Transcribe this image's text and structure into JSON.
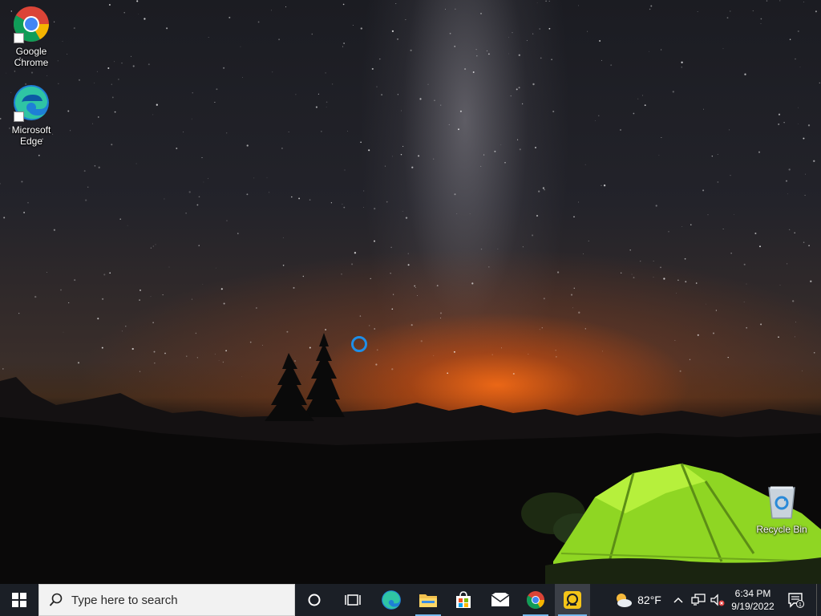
{
  "desktop": {
    "icons": [
      {
        "id": "chrome",
        "label_line1": "Google",
        "label_line2": "Chrome",
        "icon": "chrome-icon"
      },
      {
        "id": "edge",
        "label_line1": "Microsoft",
        "label_line2": "Edge",
        "icon": "edge-icon"
      },
      {
        "id": "recycle",
        "label": "Recycle Bin",
        "icon": "recycle-bin-icon"
      }
    ]
  },
  "taskbar": {
    "search_placeholder": "Type here to search",
    "weather_temp": "82°F",
    "clock_time": "6:34 PM",
    "clock_date": "9/19/2022",
    "notification_count": "1",
    "pinned": [
      "edge-icon",
      "file-explorer-icon",
      "store-icon",
      "mail-icon",
      "chrome-icon",
      "app-icon"
    ]
  },
  "colors": {
    "taskbar_bg": "#1b1f26",
    "accent_blue": "#1e8fe8",
    "running_indicator": "#76b9ed",
    "tent_green": "#9be22a"
  }
}
